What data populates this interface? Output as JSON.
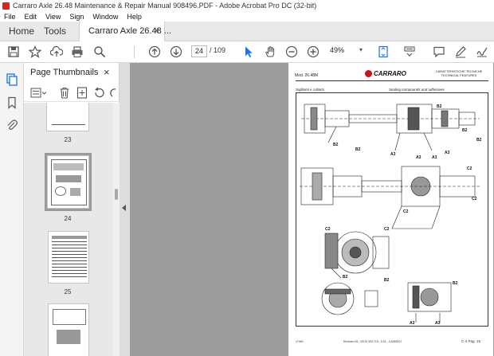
{
  "window": {
    "title": "Carraro Axle 26.48 Maintenance & Repair Manual 908496.PDF - Adobe Acrobat Pro DC (32-bit)"
  },
  "menu": [
    "File",
    "Edit",
    "View",
    "Sign",
    "Window",
    "Help"
  ],
  "tabs": {
    "home": "Home",
    "tools": "Tools",
    "document": "Carraro Axle 26.48 ...",
    "close": "×"
  },
  "toolbar": {
    "current_page": "24",
    "page_of": "/  109",
    "zoom": "49%",
    "zoom_chevron": "▾"
  },
  "panel": {
    "title": "Page Thumbnails",
    "close": "×",
    "thumbnails": [
      {
        "label": "23",
        "selected": false
      },
      {
        "label": "24",
        "selected": true
      },
      {
        "label": "25",
        "selected": false
      },
      {
        "label": "",
        "selected": false
      }
    ]
  },
  "document_page": {
    "header_left": "Mod. 26.48M",
    "logo_text": "CARRARO",
    "header_right_1": "CARATTERISTICHE TECNICHE",
    "header_right_2": "TECHNICAL FEATURES",
    "subtitle_left": "Sigillanti e collanti",
    "subtitle_right": "Sealing compounds and adhesives",
    "callouts": [
      "B2",
      "B2",
      "B2",
      "B2",
      "B2",
      "A3",
      "A3",
      "A3",
      "A3",
      "C2",
      "C2",
      "C2",
      "C2",
      "C2",
      "B2",
      "B2",
      "B2",
      "A3",
      "A3"
    ],
    "footer_left": "c7460",
    "footer_mid": "Revision 06 - 03/10    303.715 - 0.01 - CA383027",
    "footer_right": "C-4  Pag. 15"
  },
  "colors": {
    "accent_blue": "#1a73e8",
    "brand_red": "#c4161c",
    "viewer_bg": "#9d9d9d"
  },
  "icons": {
    "toolbar": [
      "save-icon",
      "bookmark-star-icon",
      "upload-icon",
      "print-icon",
      "search-icon",
      "page-up-icon",
      "page-down-icon",
      "select-arrow-icon",
      "hand-icon",
      "zoom-out-icon",
      "zoom-in-icon",
      "fit-page-icon",
      "scroll-mode-icon",
      "comment-icon",
      "pen-icon",
      "sign-icon"
    ],
    "rail": [
      "thumbnails-icon",
      "bookmarks-icon",
      "attachments-icon"
    ]
  }
}
